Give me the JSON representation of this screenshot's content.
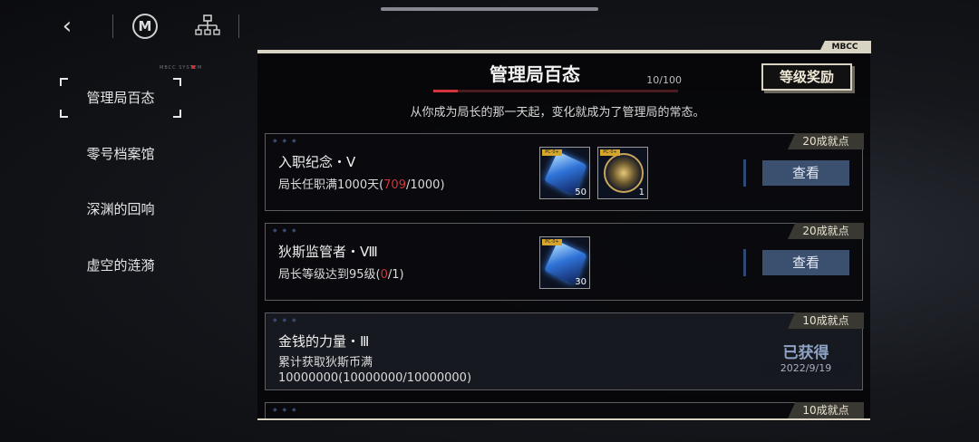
{
  "topbar": {
    "back_icon": "‹",
    "logo_text": "M"
  },
  "system_label": "MBCC SYSTEM",
  "sidebar": {
    "items": [
      {
        "label": "管理局百态",
        "selected": true
      },
      {
        "label": "零号档案馆",
        "selected": false
      },
      {
        "label": "深渊的回响",
        "selected": false
      },
      {
        "label": "虚空的涟漪",
        "selected": false
      }
    ]
  },
  "panel": {
    "badge": "MBCC",
    "title": "管理局百态",
    "progress_text": "10/100",
    "progress": 0.1,
    "subtitle": "从你成为局长的那一天起，变化就成为了管理局的常态。",
    "reward_button": "等级奖励"
  },
  "achievements": [
    {
      "tag": "20成就点",
      "title": "入职纪念・Ⅴ",
      "desc_prefix": "局长任职满1000天(",
      "desc_current": "709",
      "desc_suffix": "/1000)",
      "rewards": [
        {
          "label": "PC·0+",
          "type": "cube",
          "qty": "50"
        },
        {
          "label": "PC·0+",
          "type": "medal",
          "qty": "1"
        }
      ],
      "button": "查看"
    },
    {
      "tag": "20成就点",
      "title": "狄斯监管者・Ⅷ",
      "desc_prefix": "局长等级达到95级(",
      "desc_current": "0",
      "desc_suffix": "/1)",
      "rewards": [
        {
          "label": "PC·0+",
          "type": "cube",
          "qty": "30"
        }
      ],
      "button": "查看"
    },
    {
      "tag": "10成就点",
      "title": "金钱的力量・Ⅲ",
      "desc_line1": "累计获取狄斯币满",
      "desc_line2": "10000000(10000000/10000000)",
      "status": "已获得",
      "date": "2022/9/19"
    },
    {
      "tag": "10成就点"
    }
  ],
  "colors": {
    "accent_red": "#d4343c",
    "button_blue": "#3b4f6e",
    "frame": "#d9d3c3"
  }
}
